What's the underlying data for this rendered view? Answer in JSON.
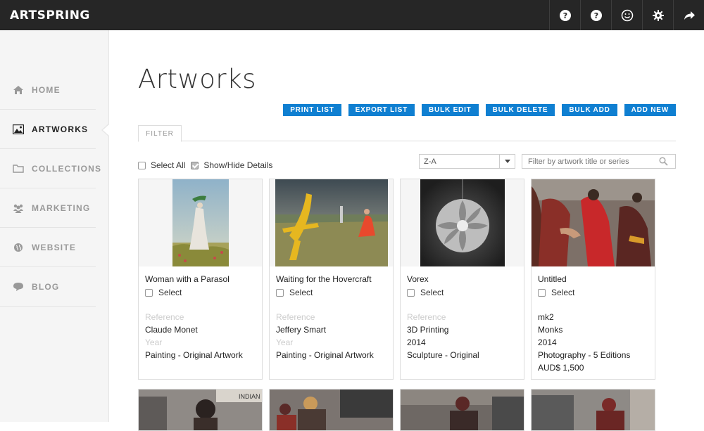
{
  "app": {
    "logo": "ARTSPRING",
    "top_icons": [
      "help-icon",
      "help-icon",
      "smiley-icon",
      "gear-icon",
      "share-arrow-icon"
    ]
  },
  "sidebar": {
    "items": [
      {
        "label": "HOME",
        "icon": "home-icon",
        "active": false
      },
      {
        "label": "ARTWORKS",
        "icon": "image-icon",
        "active": true
      },
      {
        "label": "COLLECTIONS",
        "icon": "folder-icon",
        "active": false
      },
      {
        "label": "MARKETING",
        "icon": "users-icon",
        "active": false
      },
      {
        "label": "WEBSITE",
        "icon": "globe-icon",
        "active": false
      },
      {
        "label": "BLOG",
        "icon": "chat-icon",
        "active": false
      }
    ]
  },
  "main": {
    "title": "Artworks",
    "actions": [
      "PRINT LIST",
      "EXPORT LIST",
      "BULK EDIT",
      "BULK DELETE",
      "BULK ADD",
      "ADD NEW"
    ],
    "tab": "FILTER",
    "select_all": "Select All",
    "show_hide": "Show/Hide Details",
    "sort_value": "Z-A",
    "filter_placeholder": "Filter by artwork title or series",
    "select_label": "Select",
    "cards": [
      {
        "title": "Woman with a Parasol",
        "reference_label": "Reference",
        "reference": "",
        "artist": "Claude Monet",
        "year_label": "Year",
        "year": "",
        "medium": "Painting - Original Artwork",
        "price": ""
      },
      {
        "title": "Waiting for the Hovercraft",
        "reference_label": "Reference",
        "reference": "",
        "artist": "Jeffery Smart",
        "year_label": "Year",
        "year": "",
        "medium": "Painting - Original Artwork",
        "price": ""
      },
      {
        "title": "Vorex",
        "reference_label": "Reference",
        "reference": "",
        "artist": "3D Printing",
        "year_label": "",
        "year": "2014",
        "medium": "Sculpture - Original",
        "price": ""
      },
      {
        "title": "Untitled",
        "reference_label": "",
        "reference": "mk2",
        "artist": "Monks",
        "year_label": "",
        "year": "2014",
        "medium": "Photography - 5 Editions",
        "price": "AUD$ 1,500"
      }
    ],
    "second_row_text": "INDIAN"
  },
  "colors": {
    "topbar": "#262626",
    "accent": "#0f7fd1",
    "sidebar_bg": "#f5f5f5"
  }
}
